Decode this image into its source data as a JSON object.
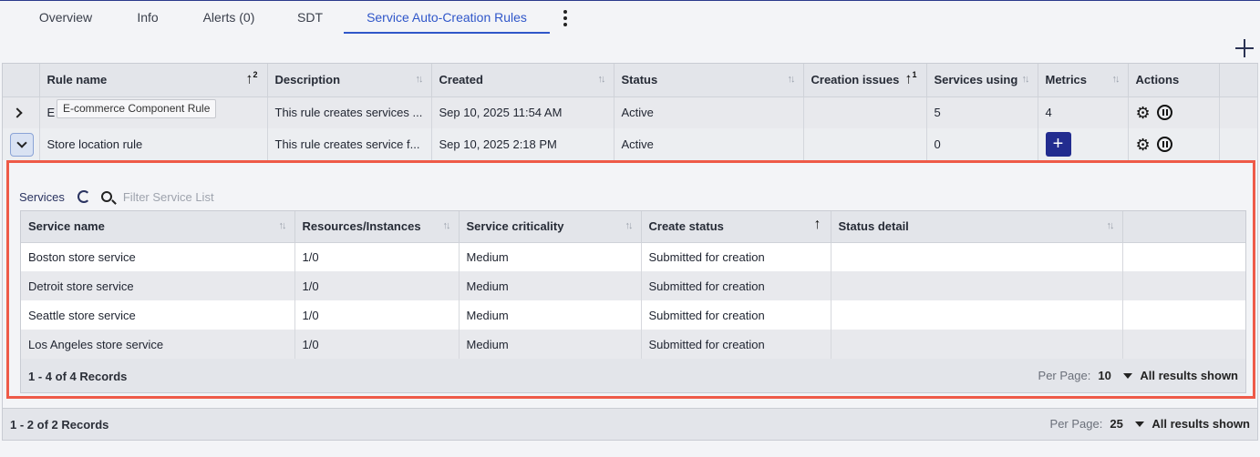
{
  "tabs": [
    "Overview",
    "Info",
    "Alerts (0)",
    "SDT",
    "Service Auto-Creation Rules"
  ],
  "rules_table": {
    "columns": [
      "Rule name",
      "Description",
      "Created",
      "Status",
      "Creation issues",
      "Services using",
      "Metrics",
      "Actions"
    ],
    "rule_name_sort_index": "2",
    "creation_issues_sort_index": "1",
    "rows": [
      {
        "name": "E-commerce Component Rule",
        "description": "This rule creates services ...",
        "created": "Sep 10, 2025 11:54 AM",
        "status": "Active",
        "issues": "",
        "services_using": "5",
        "metrics": "4"
      },
      {
        "name": "Store location rule",
        "description": "This rule creates service f...",
        "created": "Sep 10, 2025 2:18 PM",
        "status": "Active",
        "issues": "",
        "services_using": "0",
        "metrics": "+"
      }
    ],
    "tooltip": "E-commerce Component Rule",
    "row1_visible_prefix": "E",
    "records": "1 - 2 of 2 Records",
    "per_page_label": "Per Page:",
    "per_page_value": "25",
    "all_results": "All results shown"
  },
  "services_panel": {
    "label": "Services",
    "filter_placeholder": "Filter Service List",
    "columns": [
      "Service name",
      "Resources/Instances",
      "Service criticality",
      "Create status",
      "Status detail"
    ],
    "rows": [
      {
        "name": "Boston store service",
        "resources": "1/0",
        "criticality": "Medium",
        "create_status": "Submitted for creation",
        "detail": ""
      },
      {
        "name": "Detroit store service",
        "resources": "1/0",
        "criticality": "Medium",
        "create_status": "Submitted for creation",
        "detail": ""
      },
      {
        "name": "Seattle store service",
        "resources": "1/0",
        "criticality": "Medium",
        "create_status": "Submitted for creation",
        "detail": ""
      },
      {
        "name": "Los Angeles store service",
        "resources": "1/0",
        "criticality": "Medium",
        "create_status": "Submitted for creation",
        "detail": ""
      }
    ],
    "records": "1 - 4 of 4 Records",
    "per_page_label": "Per Page:",
    "per_page_value": "10",
    "all_results": "All results shown"
  },
  "icons": {
    "add": "plus-icon",
    "more": "kebab-icon",
    "settings": "gear-icon",
    "pause": "pause-icon",
    "refresh": "refresh-icon",
    "search": "search-icon",
    "expand": "chevron-icon",
    "sort": "sort-icon"
  },
  "colors": {
    "accent": "#2f56c9",
    "highlight_border": "#ee5a48",
    "add_button": "#222c8f"
  }
}
